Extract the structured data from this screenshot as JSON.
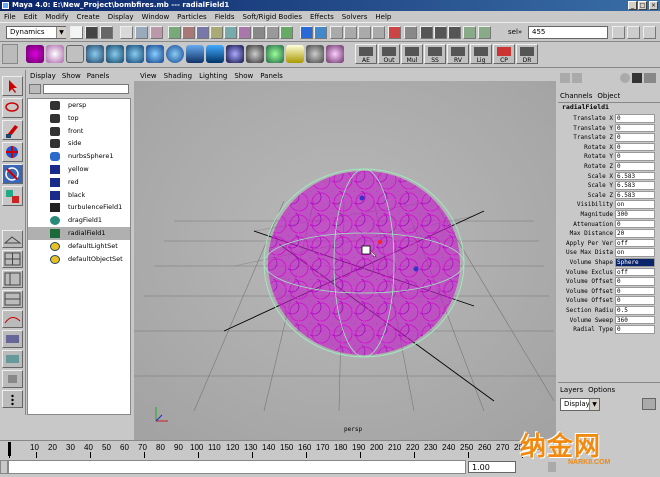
{
  "window": {
    "title": "Maya 4.0: E:\\New_Project\\bombfires.mb  ---  radialField1",
    "controls": [
      "_",
      "□",
      "×"
    ]
  },
  "menubar": [
    "File",
    "Edit",
    "Modify",
    "Create",
    "Display",
    "Window",
    "Particles",
    "Fields",
    "Soft/Rigid Bodies",
    "Effects",
    "Solvers",
    "Help"
  ],
  "status": {
    "menuset": "Dynamics",
    "sel_label": "sel»",
    "sel_value": "455"
  },
  "shelf": {
    "labeled_buttons": [
      "AE",
      "Out",
      "Mul",
      "SS",
      "RV",
      "Lig",
      "CP",
      "DR"
    ]
  },
  "outliner": {
    "menu": [
      "Display",
      "Show",
      "Panels"
    ],
    "items": [
      {
        "label": "persp",
        "icon": "camera-icon",
        "selected": false
      },
      {
        "label": "top",
        "icon": "camera-icon",
        "selected": false
      },
      {
        "label": "front",
        "icon": "camera-icon",
        "selected": false
      },
      {
        "label": "side",
        "icon": "camera-icon",
        "selected": false
      },
      {
        "label": "nurbsSphere1",
        "icon": "nurbs-icon",
        "selected": false
      },
      {
        "label": "yellow",
        "icon": "particle-icon",
        "selected": false
      },
      {
        "label": "red",
        "icon": "particle-icon",
        "selected": false
      },
      {
        "label": "black",
        "icon": "particle-icon",
        "selected": false
      },
      {
        "label": "turbulenceField1",
        "icon": "field-icon",
        "selected": false
      },
      {
        "label": "dragField1",
        "icon": "field-icon",
        "selected": false
      },
      {
        "label": "radialField1",
        "icon": "field-icon",
        "selected": true
      },
      {
        "label": "defaultLightSet",
        "icon": "set-icon",
        "selected": false
      },
      {
        "label": "defaultObjectSet",
        "icon": "set-icon",
        "selected": false
      }
    ]
  },
  "viewport": {
    "menu": [
      "View",
      "Shading",
      "Lighting",
      "Show",
      "Panels"
    ],
    "camera_label": "persp"
  },
  "channels": {
    "menu": [
      "Channels",
      "Object"
    ],
    "node": "radialField1",
    "rows": [
      {
        "name": "Translate X",
        "value": "0"
      },
      {
        "name": "Translate Y",
        "value": "0"
      },
      {
        "name": "Translate Z",
        "value": "0"
      },
      {
        "name": "Rotate X",
        "value": "0"
      },
      {
        "name": "Rotate Y",
        "value": "0"
      },
      {
        "name": "Rotate Z",
        "value": "0"
      },
      {
        "name": "Scale X",
        "value": "6.583"
      },
      {
        "name": "Scale Y",
        "value": "6.583"
      },
      {
        "name": "Scale Z",
        "value": "6.583"
      },
      {
        "name": "Visibility",
        "value": "on"
      },
      {
        "name": "Magnitude",
        "value": "300"
      },
      {
        "name": "Attenuation",
        "value": "0"
      },
      {
        "name": "Max Distance",
        "value": "20"
      },
      {
        "name": "Apply Per Ver",
        "value": "off"
      },
      {
        "name": "Use Max Dista",
        "value": "on"
      },
      {
        "name": "Volume Shape",
        "value": "Sphere"
      },
      {
        "name": "Volume Exclus",
        "value": "off"
      },
      {
        "name": "Volume Offset",
        "value": "0"
      },
      {
        "name": "Volume Offset",
        "value": "0"
      },
      {
        "name": "Volume Offset",
        "value": "0"
      },
      {
        "name": "Section Radiu",
        "value": "0.5"
      },
      {
        "name": "Volume Sweep",
        "value": "360"
      },
      {
        "name": "Radial Type",
        "value": "0"
      }
    ],
    "layers_menu": [
      "Layers",
      "Options"
    ],
    "layers_dropdown": "Display"
  },
  "timeline": {
    "ticks": [
      "10",
      "20",
      "30",
      "40",
      "50",
      "60",
      "70",
      "80",
      "90",
      "100",
      "110",
      "120",
      "130",
      "140",
      "150",
      "160",
      "170",
      "180",
      "190",
      "200",
      "210",
      "220",
      "230",
      "240",
      "250",
      "260",
      "270",
      "280",
      "290"
    ],
    "start_field": "1.00"
  },
  "watermark": {
    "text": "纳金网",
    "url": "NARKII.COM"
  }
}
